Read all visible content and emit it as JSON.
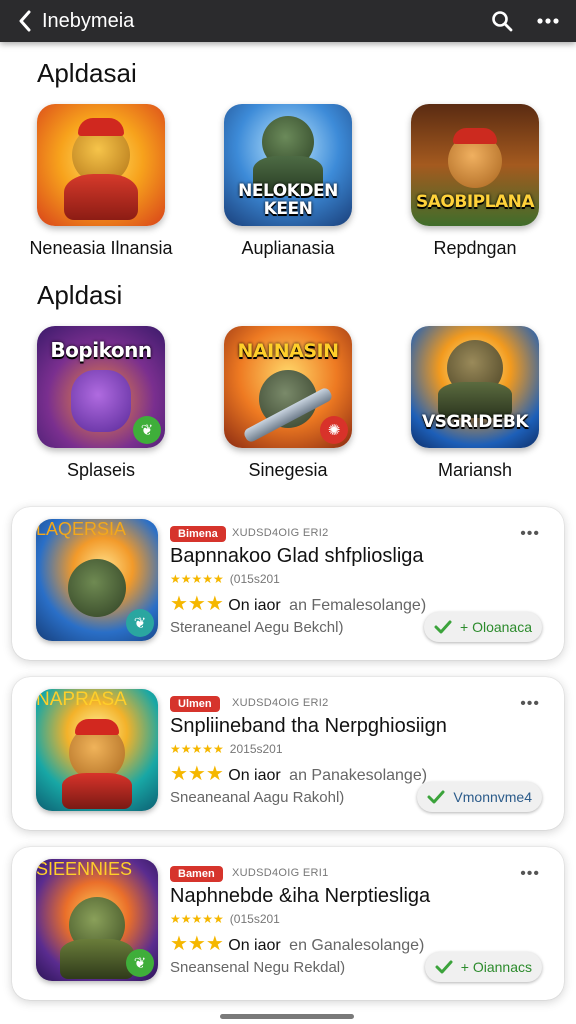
{
  "header": {
    "title": "Inebymeia",
    "back_icon": "chevron-left-icon",
    "search_icon": "search-icon",
    "more_icon": "more-horizontal-icon"
  },
  "sections": [
    {
      "title": "Apldasai",
      "apps": [
        {
          "name": "Neneasia Ilnansia",
          "art_title": "",
          "colors": [
            "#f7c21c",
            "#e8551b"
          ]
        },
        {
          "name": "Auplianasia",
          "art_title": "NELOKDEN KEEN",
          "colors": [
            "#2a6fc7",
            "#8fd3f5"
          ]
        },
        {
          "name": "Repdngan",
          "art_title": "SAOBIPLANA",
          "colors": [
            "#7a3c16",
            "#e7a531"
          ]
        }
      ]
    },
    {
      "title": "Apldasi",
      "apps": [
        {
          "name": "Splaseis",
          "art_title": "Bopikonn",
          "colors": [
            "#4a2a8f",
            "#f07c1e"
          ]
        },
        {
          "name": "Sinegesia",
          "art_title": "NAINASIN",
          "colors": [
            "#e3581a",
            "#f6c23b"
          ]
        },
        {
          "name": "Mariansh",
          "art_title": "VSGRIDEBK",
          "colors": [
            "#1d5fb8",
            "#f2a516"
          ]
        }
      ]
    }
  ],
  "cards": [
    {
      "art_title": "LAQERSIA",
      "tag": "Bimena",
      "meta": "XUDSD4OIG ERI2",
      "title": "Bapnnakoo Glad shfpliosliga",
      "stars": "★★★★★",
      "date": "(015s201",
      "rating_stars": "★★★",
      "rating_text": "On iaor",
      "rating_sub": "an Femalesolange)",
      "seller": "Steraneanel Aegu Bekchl)",
      "action": "+ Oloanaca",
      "colors": [
        "#1c4f9e",
        "#7cc7e9"
      ]
    },
    {
      "art_title": "NAPRASA",
      "tag": "Ulmen",
      "meta": "XUDSD4OIG ERI2",
      "title": "Snpliineband tha Nerpghiosiign",
      "stars": "★★★★★",
      "date": "2015s201",
      "rating_stars": "★★★",
      "rating_text": "On iaor",
      "rating_sub": "an Panakesolange)",
      "seller": "Sneaneanal Aagu Rakohl)",
      "action": "Vmonnvme4",
      "colors": [
        "#0f9aa5",
        "#ffd24a"
      ]
    },
    {
      "art_title": "SIEENNIES",
      "tag": "Bamen",
      "meta": "XUDSD4OIG ERI1",
      "title": "Naphnebde &iha Nerptiesliga",
      "stars": "★★★★★",
      "date": "(015s201",
      "rating_stars": "★★★",
      "rating_text": "On iaor",
      "rating_sub": "en Ganalesolange)",
      "seller": "Sneansenal Negu Rekdal)",
      "action": "+ Oiannacs",
      "colors": [
        "#4b2a8d",
        "#f08a2a"
      ]
    }
  ]
}
